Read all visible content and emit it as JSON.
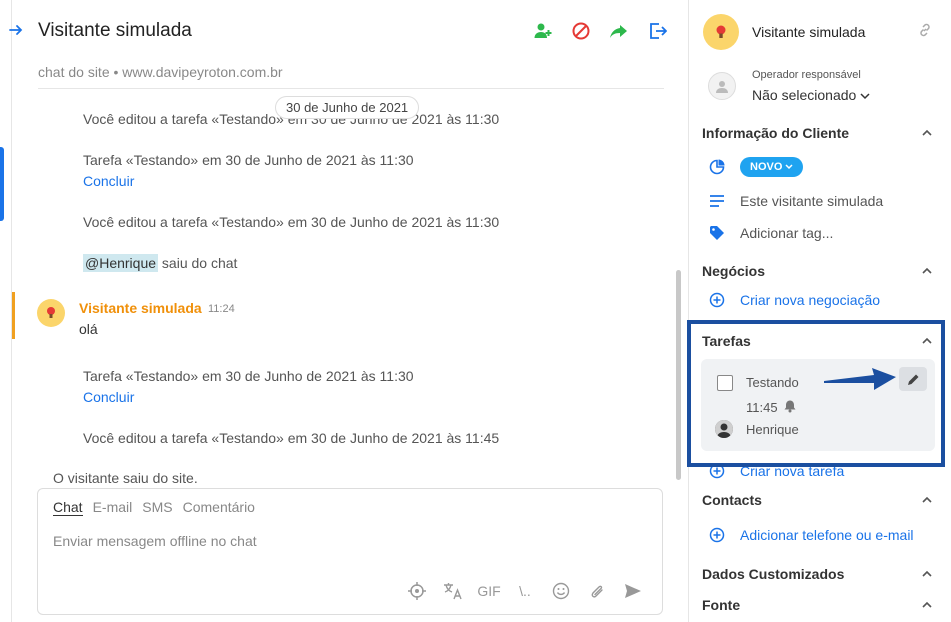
{
  "header": {
    "title": "Visitante simulada",
    "subtitle": "chat do site • www.davipeyroton.com.br"
  },
  "chat": {
    "date_pill": "30 de Junho de 2021",
    "messages": [
      {
        "text": "Você editou a tarefa «Testando» em 30 de Junho de 2021 às 11:30"
      },
      {
        "text": "Tarefa «Testando» em 30 de Junho de 2021 às 11:30",
        "link": "Concluir"
      },
      {
        "text": "Você editou a tarefa «Testando» em 30 de Junho de 2021 às 11:30"
      },
      {
        "mention": "@Henrique",
        "text": "saiu do chat"
      },
      {
        "text": "Tarefa «Testando» em 30 de Junho de 2021 às 11:30",
        "link": "Concluir"
      },
      {
        "text": "Você editou a tarefa «Testando» em 30 de Junho de 2021 às 11:45"
      }
    ],
    "visitor_message": {
      "name": "Visitante simulada",
      "time": "11:24",
      "text": "olá"
    },
    "left_site": "O visitante saiu do site."
  },
  "composer": {
    "tabs": [
      "Chat",
      "E-mail",
      "SMS",
      "Comentário"
    ],
    "active_tab": "Chat",
    "placeholder": "Enviar mensagem offline no chat",
    "gif_label": "GIF",
    "slash_label": "\\.."
  },
  "sidebar": {
    "name": "Visitante simulada",
    "operator_label": "Operador responsável",
    "operator_value": "Não selecionado",
    "client_info": {
      "title": "Informação do Cliente",
      "status_badge": "NOVO",
      "description": "Este visitante simulada",
      "add_tag": "Adicionar tag..."
    },
    "deals": {
      "title": "Negócios",
      "create": "Criar nova negociação"
    },
    "tasks": {
      "title": "Tarefas",
      "item": {
        "name": "Testando",
        "time": "11:45",
        "user": "Henrique"
      },
      "create": "Criar nova tarefa"
    },
    "contacts": {
      "title": "Contacts",
      "add": "Adicionar telefone ou e-mail"
    },
    "custom": {
      "title": "Dados Customizados"
    },
    "source": {
      "title": "Fonte"
    }
  },
  "colors": {
    "accent": "#1a73e8",
    "visitor": "#f0900a",
    "badge": "#1fa3f0",
    "highlight": "#1b4fa0",
    "green": "#2db84c",
    "red": "#e53935"
  }
}
